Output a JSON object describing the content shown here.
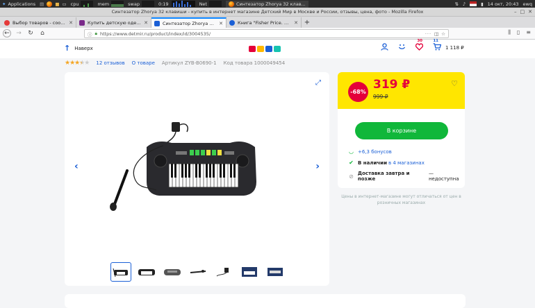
{
  "os": {
    "applications": "Applications",
    "cpu": "cpu",
    "mem": "mem",
    "swap": "swap",
    "time_counter": "0:19",
    "net": "Net",
    "task_title": "Синтезатор Zhorya 32 клав...",
    "clock": "14 окт, 20:43",
    "user": "ewq"
  },
  "window": {
    "title": "Синтезатор Zhorya 32 клавиши - купить в интернет магазине Детский Мир в Москве и России, отзывы, цена, фото - Mozilla Firefox"
  },
  "tabs": [
    {
      "label": "Выбор товаров - сообщество...",
      "color": "#e53a3a"
    },
    {
      "label": "Купить детскую одежду в и...",
      "color": "#7a2a8a"
    },
    {
      "label": "Синтезатор Zhorya 32 клав...",
      "color": "#1a5fd6"
    },
    {
      "label": "Книга \"Fisher Price. Лев. Ки...",
      "color": "#1a5fd6"
    }
  ],
  "nav": {
    "url": "https://www.detmir.ru/product/index/id/3004535/"
  },
  "header": {
    "up_label": "Наверх",
    "favorites_count": "30",
    "cart_count": "11",
    "cart_sum": "1 118 ₽"
  },
  "product": {
    "rating": 3.5,
    "reviews": "12 отзывов",
    "about": "О товаре",
    "article": "Артикул ZYB-B0690-1",
    "code": "Код товара 1000049454"
  },
  "price": {
    "discount": "-68%",
    "current": "319 ₽",
    "old": "999 ₽",
    "buy_label": "В корзине",
    "bonus": "+6,3 бонусов",
    "stock_prefix": "В наличии",
    "stock_link": "в 4 магазинах",
    "delivery_bold": "Доставка завтра и позже",
    "delivery_rest": " — недоступна",
    "note": "Цены в интернет-магазине могут отличаться от цен в розничных магазинах"
  },
  "colors": {
    "accent_blue": "#1a5fd6",
    "sale_red": "#e4003a",
    "price_yellow": "#ffe600",
    "buy_green": "#10b73a"
  }
}
